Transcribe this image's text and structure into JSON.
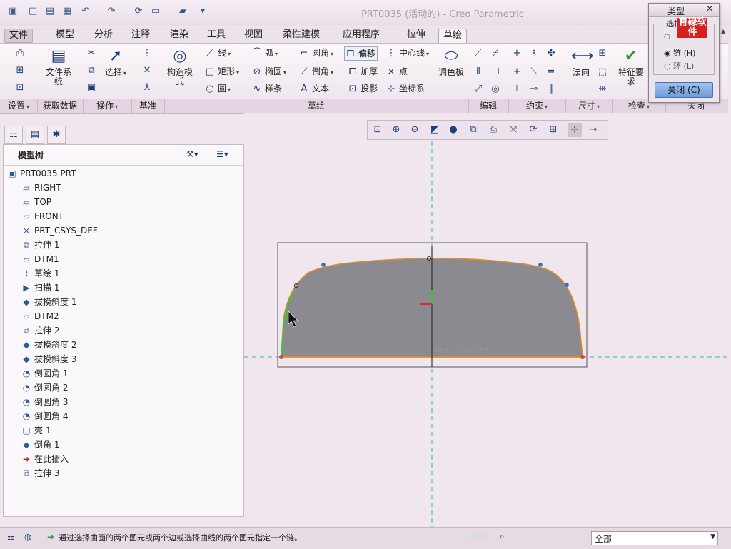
{
  "window_title": "PRT0035 (活动的) - Creo Parametric",
  "menu_tabs": [
    "文件",
    "模型",
    "分析",
    "注释",
    "渲染",
    "工具",
    "视图",
    "柔性建模",
    "应用程序",
    "拉伸",
    "草绘"
  ],
  "ribbon": {
    "setup": {
      "coord_system": "文件系统"
    },
    "operations": {
      "select": "选择"
    },
    "base": {
      "construction_mode": "构造模式"
    },
    "sketch": {
      "line": "线",
      "arc": "弧",
      "fillet": "圆角",
      "offset": "偏移",
      "centerline": "中心线",
      "rectangle": "矩形",
      "ellipse": "椭圆",
      "chamfer": "倒角",
      "thicken": "加厚",
      "point": "点",
      "circle": "圆",
      "spline": "样条",
      "text": "文本",
      "project": "投影",
      "coordsys": "坐标系",
      "palette": "调色板"
    },
    "dimension": {
      "normal": "法向"
    },
    "inspect": {
      "feature_req": "特征要求"
    },
    "groups": [
      "设置",
      "获取数据",
      "操作",
      "基准",
      "草绘",
      "编辑",
      "约束",
      "尺寸",
      "检查",
      "关闭"
    ]
  },
  "model_tree": {
    "title": "模型树",
    "root": "PRT0035.PRT",
    "items": [
      "RIGHT",
      "TOP",
      "FRONT",
      "PRT_CSYS_DEF",
      "拉伸 1",
      "DTM1",
      "草绘 1",
      "扫描 1",
      "拔模斜度 1",
      "DTM2",
      "拉伸 2",
      "拔模斜度 2",
      "拔模斜度 3",
      "倒圆角 1",
      "倒圆角 2",
      "倒圆角 3",
      "倒圆角 4",
      "壳 1",
      "倒角 1",
      "在此插入",
      "拉伸 3"
    ]
  },
  "canvas": {
    "csys_label": "PRT_CSYS_DEF"
  },
  "dialog": {
    "title": "类型",
    "group": "选择",
    "options": [
      "",
      "链 (H)",
      "环 (L)"
    ],
    "selected": "链 (H)",
    "close_button": "关闭 (C)",
    "watermark": "育碌软件"
  },
  "status": {
    "message": "通过选择曲面的两个图元或两个边或选择曲线的两个图元指定一个链。",
    "filter": "全部"
  },
  "colors": {
    "accent": "#2f6fd0",
    "shape_fill": "#8a8a90",
    "shape_edge": "#e08a2a"
  }
}
